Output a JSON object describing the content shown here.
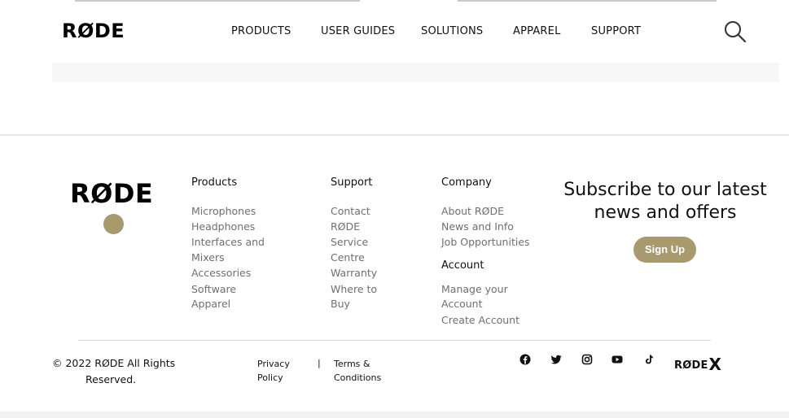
{
  "brand": {
    "logo_text": "RØDE"
  },
  "nav": {
    "items": [
      "PRODUCTS",
      "USER GUIDES",
      "SOLUTIONS",
      "APPAREL",
      "SUPPORT"
    ]
  },
  "footer": {
    "products": {
      "heading": "Products",
      "links": [
        "Microphones",
        "Headphones",
        "Interfaces and",
        "Mixers",
        "Accessories",
        "Software",
        "Apparel"
      ]
    },
    "support": {
      "heading": "Support",
      "links": [
        "Contact",
        "RØDE",
        "Service",
        "Centre",
        "Warranty",
        "Where to",
        "Buy"
      ]
    },
    "company": {
      "heading": "Company",
      "links": [
        "About RØDE",
        "News and Info",
        "Job Opportunities"
      ]
    },
    "account": {
      "heading": "Account",
      "links": [
        "Manage your",
        "Account",
        "Create Account"
      ]
    },
    "subscribe": {
      "line1": "Subscribe to our latest",
      "line2": "news and offers",
      "button": "Sign Up"
    },
    "copyright": {
      "line1": "© 2022 RØDE All Rights",
      "line2": "Reserved."
    },
    "legal": {
      "privacy1": "Privacy",
      "privacy2": "Policy",
      "separator": "|",
      "terms1": "Terms &",
      "terms2": "Conditions"
    },
    "social_icons": [
      "facebook-icon",
      "twitter-icon",
      "instagram-icon",
      "youtube-icon",
      "tiktok-icon"
    ],
    "rodex": {
      "text": "RØDE",
      "x": "X"
    }
  },
  "colors": {
    "accent": "#a89a6c",
    "text": "#111111",
    "muted": "#6f6f6f"
  }
}
